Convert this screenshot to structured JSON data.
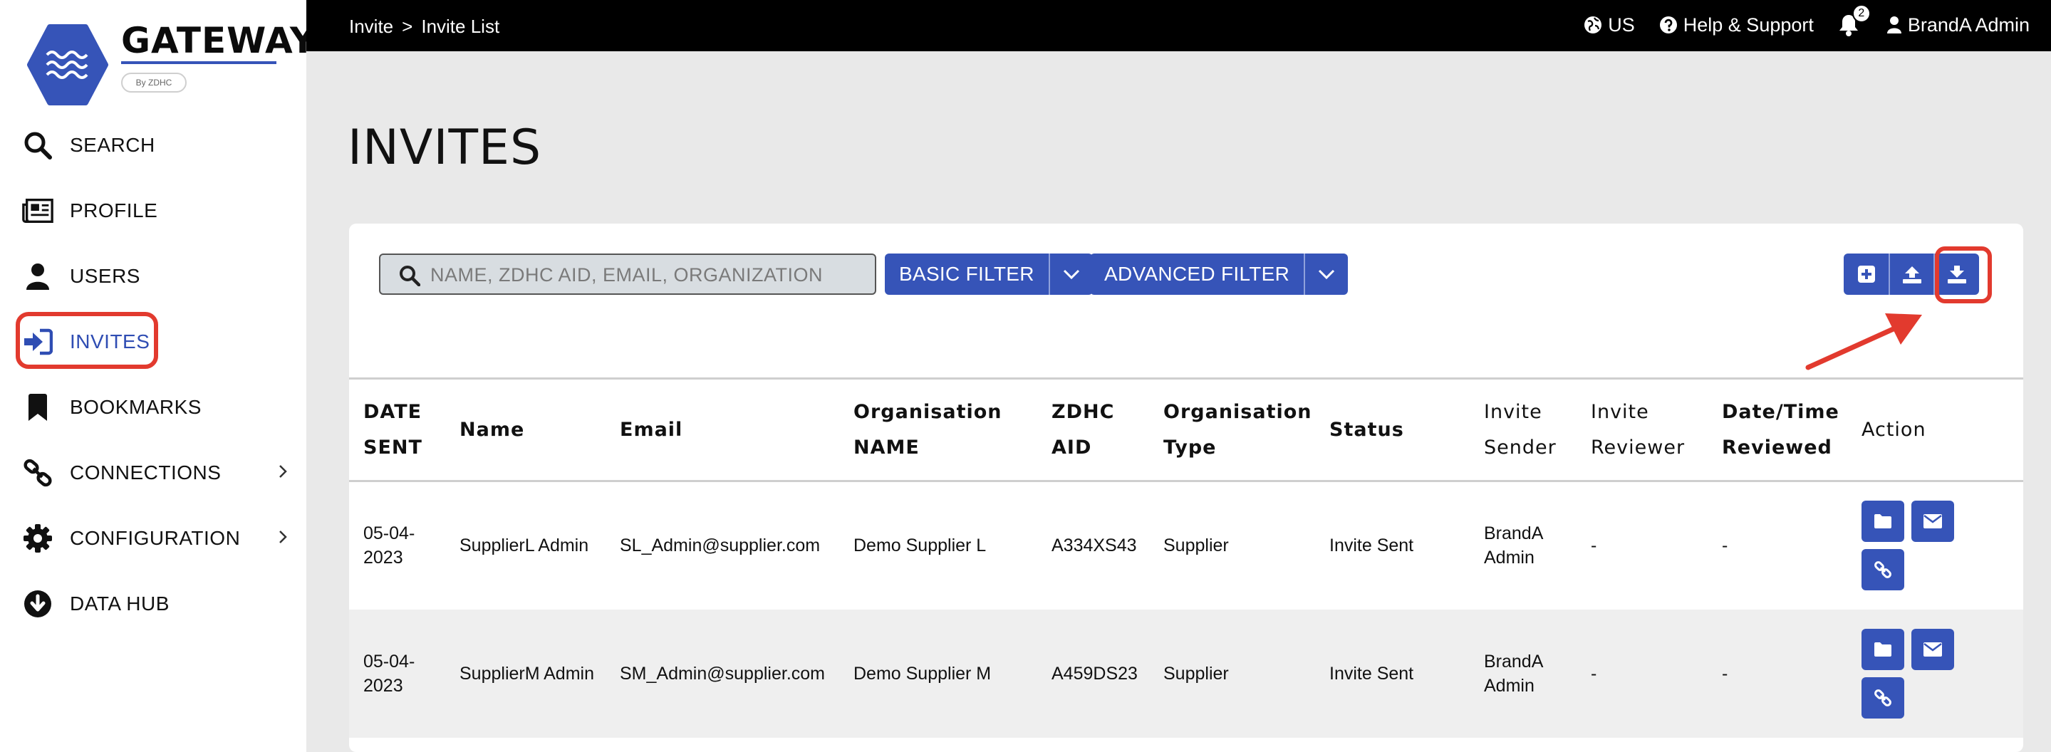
{
  "brand": {
    "name": "GATEWAY",
    "tagline": "By ZDHC",
    "accent": "#3654b8",
    "highlight": "#e23a2e"
  },
  "sidebar": {
    "items": [
      {
        "label": "SEARCH",
        "icon": "search-icon"
      },
      {
        "label": "PROFILE",
        "icon": "newspaper-icon"
      },
      {
        "label": "USERS",
        "icon": "user-icon"
      },
      {
        "label": "INVITES",
        "icon": "sign-in-icon",
        "active": true
      },
      {
        "label": "BOOKMARKS",
        "icon": "bookmark-icon"
      },
      {
        "label": "CONNECTIONS",
        "icon": "link-icon",
        "has_submenu": true
      },
      {
        "label": "CONFIGURATION",
        "icon": "gear-icon",
        "has_submenu": true
      },
      {
        "label": "DATA HUB",
        "icon": "download-circle-icon"
      }
    ]
  },
  "topbar": {
    "breadcrumb": [
      "Invite",
      "Invite List"
    ],
    "breadcrumb_sep": ">",
    "region": "US",
    "help": "Help & Support",
    "notification_count": "2",
    "user": "BrandA Admin"
  },
  "page": {
    "title": "INVITES"
  },
  "toolbar": {
    "search_placeholder": "NAME, ZDHC AID, EMAIL, ORGANIZATION",
    "basic_filter": "BASIC FILTER",
    "advanced_filter": "ADVANCED FILTER",
    "action_icons": [
      "plus-square-icon",
      "upload-icon",
      "download-icon"
    ]
  },
  "table": {
    "headers": [
      [
        "DATE",
        "SENT"
      ],
      [
        "Name"
      ],
      [
        "Email"
      ],
      [
        "Organisation",
        "NAME"
      ],
      [
        "ZDHC",
        "AID"
      ],
      [
        "Organisation",
        "Type"
      ],
      [
        "Status"
      ],
      [
        "Invite",
        "Sender"
      ],
      [
        "Invite",
        "Reviewer"
      ],
      [
        "Date/Time",
        "Reviewed"
      ],
      [
        "Action"
      ]
    ],
    "rows": [
      {
        "date": [
          "05-04-",
          "2023"
        ],
        "name": "SupplierL Admin",
        "email": "SL_Admin@supplier.com",
        "org_name": "Demo Supplier L",
        "aid": "A334XS43",
        "org_type": "Supplier",
        "status": "Invite Sent",
        "sender": [
          "BrandA",
          "Admin"
        ],
        "reviewer": "-",
        "reviewed": "-"
      },
      {
        "date": [
          "05-04-",
          "2023"
        ],
        "name": "SupplierM Admin",
        "email": "SM_Admin@supplier.com",
        "org_name": "Demo Supplier M",
        "aid": "A459DS23",
        "org_type": "Supplier",
        "status": "Invite Sent",
        "sender": [
          "BrandA",
          "Admin"
        ],
        "reviewer": "-",
        "reviewed": "-"
      }
    ]
  }
}
